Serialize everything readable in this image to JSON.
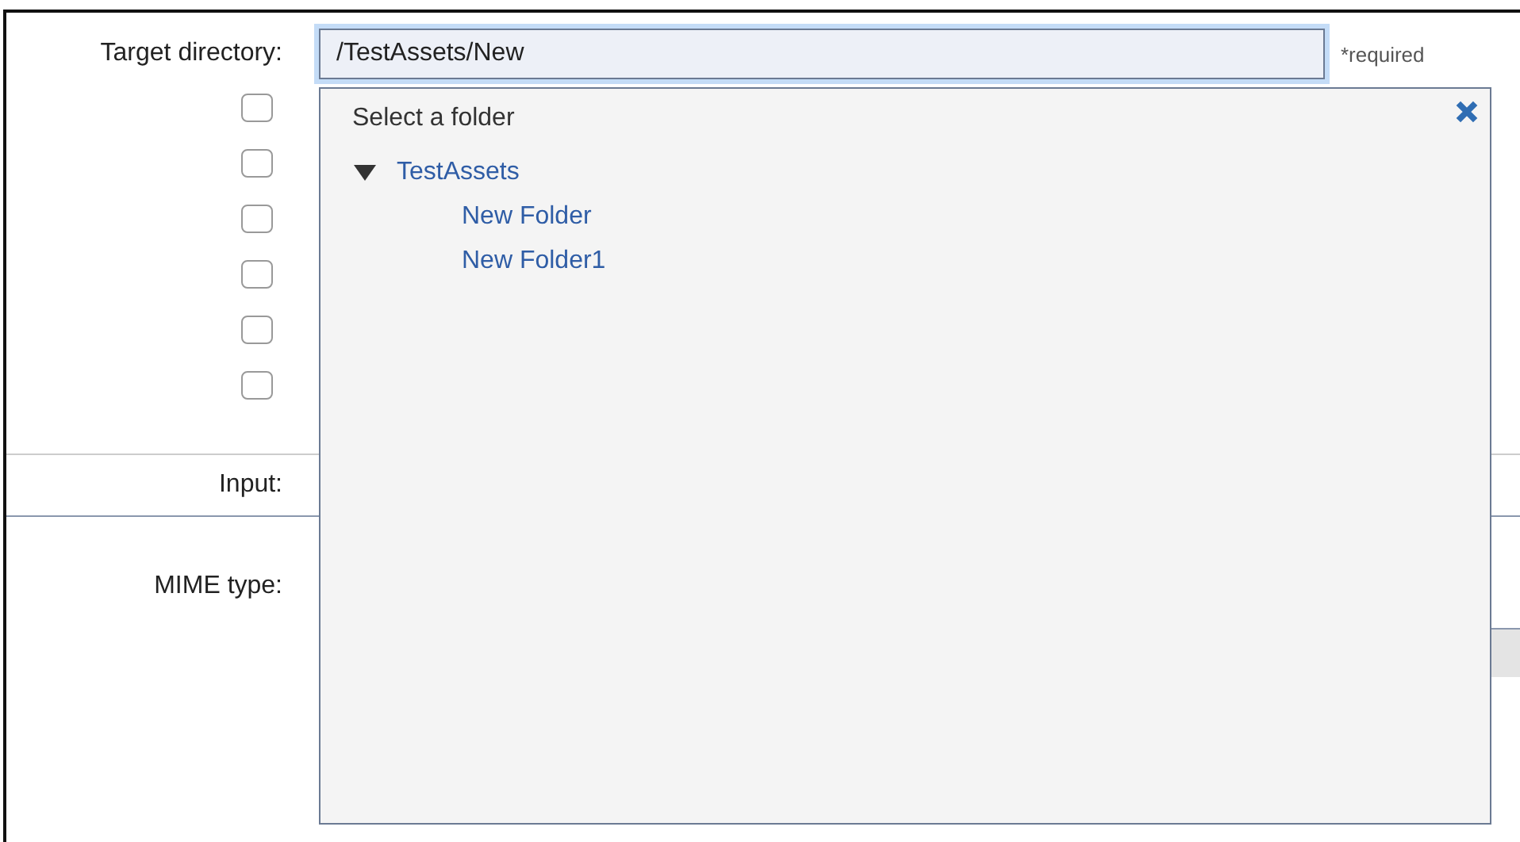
{
  "form": {
    "target_directory": {
      "label": "Target directory:",
      "value": "/TestAssets/New",
      "required_note": "*required"
    },
    "options": [
      {
        "checked": false
      },
      {
        "checked": false
      },
      {
        "checked": false
      },
      {
        "checked": false
      },
      {
        "checked": false
      },
      {
        "checked": false
      }
    ],
    "input": {
      "label": "Input:"
    },
    "mime_type": {
      "label": "MIME type:"
    }
  },
  "folder_picker": {
    "title": "Select a folder",
    "tree": [
      {
        "name": "TestAssets",
        "expanded": true,
        "children": [
          {
            "name": "New Folder"
          },
          {
            "name": "New Folder1"
          }
        ]
      }
    ]
  }
}
